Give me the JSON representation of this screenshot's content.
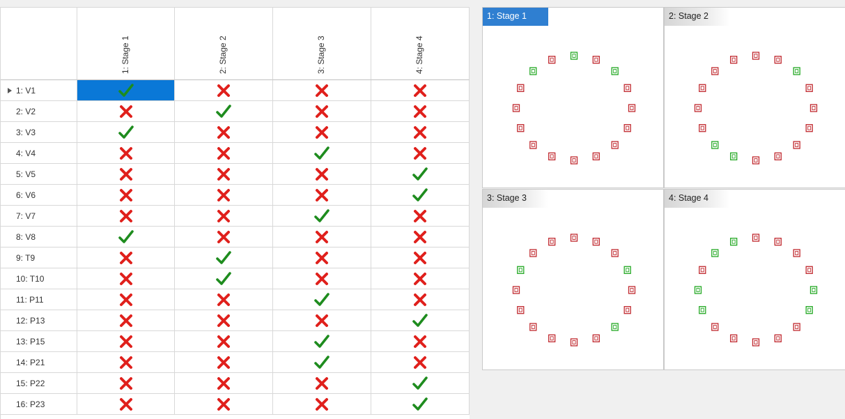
{
  "grid": {
    "columns": [
      "1: Stage 1",
      "2: Stage 2",
      "3: Stage 3",
      "4: Stage 4"
    ],
    "current_row": 0,
    "selected_cell": {
      "row": 0,
      "col": 0
    },
    "rows": [
      {
        "label": "1: V1",
        "values": [
          true,
          false,
          false,
          false
        ]
      },
      {
        "label": "2: V2",
        "values": [
          false,
          true,
          false,
          false
        ]
      },
      {
        "label": "3: V3",
        "values": [
          true,
          false,
          false,
          false
        ]
      },
      {
        "label": "4: V4",
        "values": [
          false,
          false,
          true,
          false
        ]
      },
      {
        "label": "5: V5",
        "values": [
          false,
          false,
          false,
          true
        ]
      },
      {
        "label": "6: V6",
        "values": [
          false,
          false,
          false,
          true
        ]
      },
      {
        "label": "7: V7",
        "values": [
          false,
          false,
          true,
          false
        ]
      },
      {
        "label": "8: V8",
        "values": [
          true,
          false,
          false,
          false
        ]
      },
      {
        "label": "9: T9",
        "values": [
          false,
          true,
          false,
          false
        ]
      },
      {
        "label": "10: T10",
        "values": [
          false,
          true,
          false,
          false
        ]
      },
      {
        "label": "11: P11",
        "values": [
          false,
          false,
          true,
          false
        ]
      },
      {
        "label": "12: P13",
        "values": [
          false,
          false,
          false,
          true
        ]
      },
      {
        "label": "13: P15",
        "values": [
          false,
          false,
          true,
          false
        ]
      },
      {
        "label": "14: P21",
        "values": [
          false,
          false,
          true,
          false
        ]
      },
      {
        "label": "15: P22",
        "values": [
          false,
          false,
          false,
          true
        ]
      },
      {
        "label": "16: P23",
        "values": [
          false,
          false,
          false,
          true
        ]
      }
    ]
  },
  "views": [
    {
      "title": "1: Stage 1",
      "active": true,
      "green_nodes": [
        0,
        2,
        14
      ]
    },
    {
      "title": "2: Stage 2",
      "active": false,
      "green_nodes": [
        2,
        9,
        10
      ]
    },
    {
      "title": "3: Stage 3",
      "active": false,
      "green_nodes": [
        3,
        6,
        13
      ]
    },
    {
      "title": "4: Stage 4",
      "active": false,
      "green_nodes": [
        4,
        5,
        11,
        12,
        14,
        15
      ]
    }
  ],
  "colors": {
    "check": "#1e8c1e",
    "cross": "#e0201c",
    "node_red": "#c0282e",
    "node_green": "#22a822",
    "selection": "#0a78d7"
  }
}
